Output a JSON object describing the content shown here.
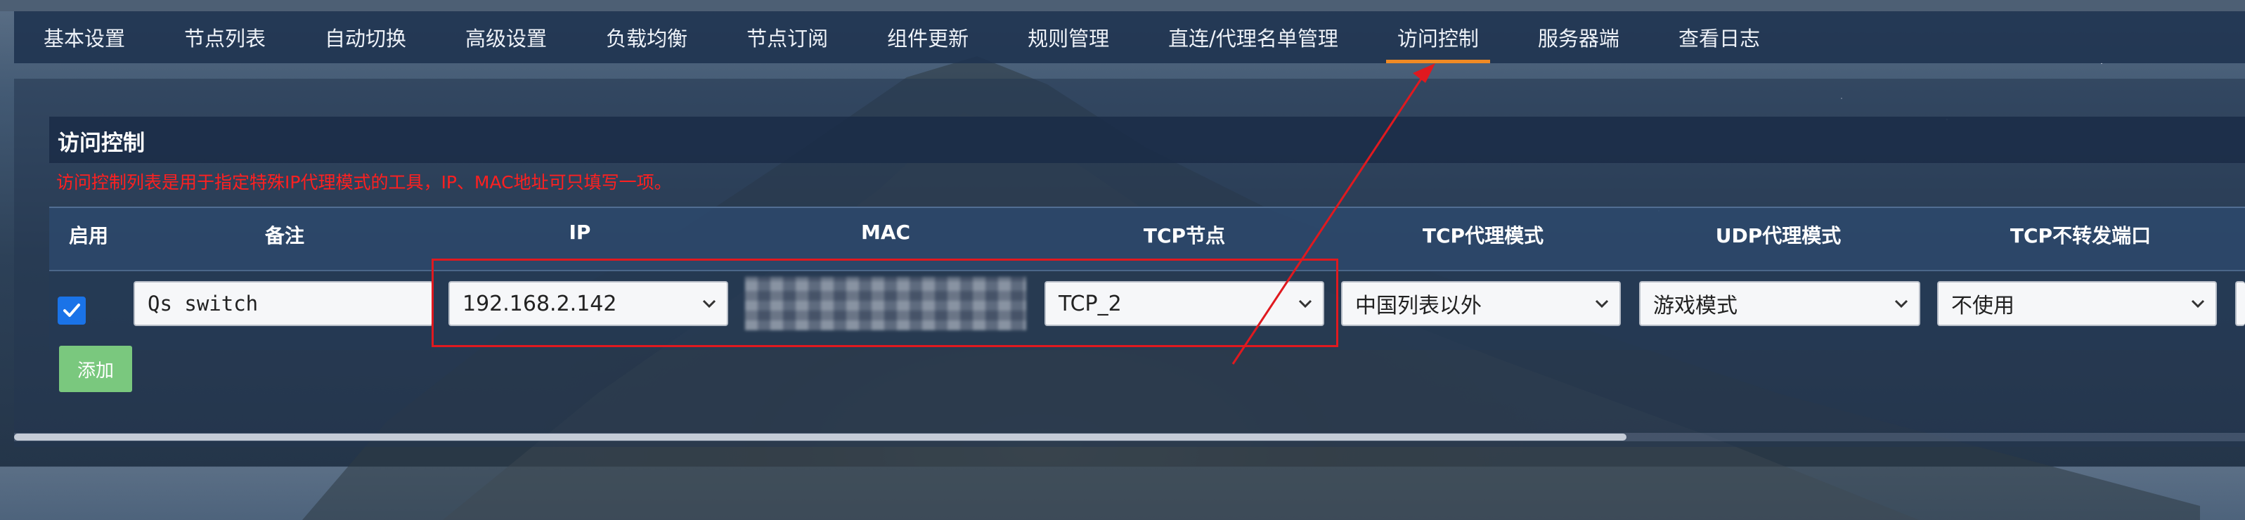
{
  "nav": {
    "tabs": [
      {
        "label": "基本设置",
        "active": false
      },
      {
        "label": "节点列表",
        "active": false
      },
      {
        "label": "自动切换",
        "active": false
      },
      {
        "label": "高级设置",
        "active": false
      },
      {
        "label": "负载均衡",
        "active": false
      },
      {
        "label": "节点订阅",
        "active": false
      },
      {
        "label": "组件更新",
        "active": false
      },
      {
        "label": "规则管理",
        "active": false
      },
      {
        "label": "直连/代理名单管理",
        "active": false
      },
      {
        "label": "访问控制",
        "active": true
      },
      {
        "label": "服务器端",
        "active": false
      },
      {
        "label": "查看日志",
        "active": false
      }
    ]
  },
  "section": {
    "title": "访问控制",
    "description": "访问控制列表是用于指定特殊IP代理模式的工具，IP、MAC地址可只填写一项。"
  },
  "table": {
    "headers": [
      "启用",
      "备注",
      "IP",
      "MAC",
      "TCP节点",
      "TCP代理模式",
      "UDP代理模式",
      "TCP不转发端口"
    ],
    "row": {
      "enabled": true,
      "remark": "Qs switch",
      "ip": "192.168.2.142",
      "mac": "",
      "tcp_node": "TCP_2",
      "tcp_mode": "中国列表以外",
      "udp_mode": "游戏模式",
      "tcp_no_forward_port": "不使用"
    }
  },
  "add_button": "添加",
  "colors": {
    "accent": "#f08a24",
    "annotation": "#e0191f",
    "add_button": "#7ac87e",
    "checkbox": "#1a73e8"
  }
}
